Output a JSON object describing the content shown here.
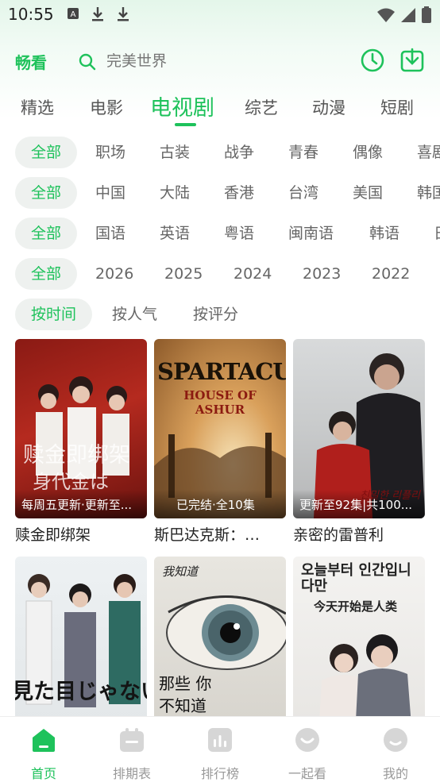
{
  "status_bar": {
    "time": "10:55"
  },
  "app": {
    "logo": "畅看"
  },
  "search": {
    "placeholder": "完美世界"
  },
  "tabs": [
    {
      "label": "精选"
    },
    {
      "label": "电影"
    },
    {
      "label": "电视剧",
      "active": true
    },
    {
      "label": "综艺"
    },
    {
      "label": "动漫"
    },
    {
      "label": "短剧"
    }
  ],
  "filters": {
    "genre": [
      "全部",
      "职场",
      "古装",
      "战争",
      "青春",
      "偶像",
      "喜剧"
    ],
    "region": [
      "全部",
      "中国",
      "大陆",
      "香港",
      "台湾",
      "美国",
      "韩国"
    ],
    "language": [
      "全部",
      "国语",
      "英语",
      "粤语",
      "闽南语",
      "韩语",
      "日语"
    ],
    "year": [
      "全部",
      "2026",
      "2025",
      "2024",
      "2023",
      "2022"
    ],
    "sort": [
      "按时间",
      "按人气",
      "按评分"
    ]
  },
  "shows": [
    {
      "title": "赎金即绑架",
      "badge": "每周五更新·更新至...",
      "poster_text": "赎金即绑架",
      "poster_sub": "身代金は"
    },
    {
      "title": "斯巴达克斯：…",
      "badge": "已完结·全10集",
      "poster_text": "SPARTACUS",
      "poster_sub": "HOUSE OF ASHUR"
    },
    {
      "title": "亲密的雷普利",
      "badge": "更新至92集|共100...",
      "poster_text": "친밀한 리플리",
      "poster_sub": ""
    },
    {
      "title": "",
      "badge": "",
      "poster_text": "見た目じゃないと思",
      "poster_sub": ""
    },
    {
      "title": "",
      "badge": "",
      "poster_text": "那些 你不知道",
      "poster_sub": "我知道"
    },
    {
      "title": "",
      "badge": "",
      "poster_text": "오늘부터 인간입니다만",
      "poster_sub": "今天开始是人类"
    }
  ],
  "bottom_nav": [
    {
      "label": "首页",
      "active": true,
      "icon": "home-icon"
    },
    {
      "label": "排期表",
      "icon": "calendar-icon"
    },
    {
      "label": "排行榜",
      "icon": "chart-icon"
    },
    {
      "label": "一起看",
      "icon": "smile-icon"
    },
    {
      "label": "我的",
      "icon": "profile-icon"
    }
  ],
  "colors": {
    "accent": "#1ec25b",
    "chip_bg": "#eef1ef"
  }
}
